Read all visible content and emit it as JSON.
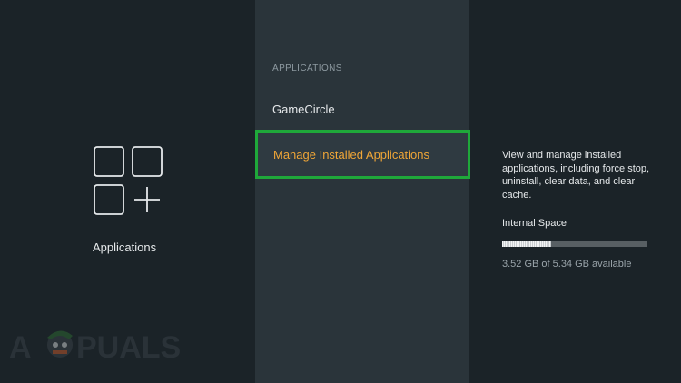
{
  "left": {
    "category_icon": "applications-grid-icon",
    "category_label": "Applications"
  },
  "center": {
    "section_header": "APPLICATIONS",
    "items": [
      {
        "label": "GameCircle",
        "selected": false
      },
      {
        "label": "Manage Installed Applications",
        "selected": true
      }
    ]
  },
  "right": {
    "description": "View and manage installed applications, including force stop, uninstall, clear data, and clear cache.",
    "storage": {
      "title": "Internal Space",
      "used_fraction": 0.34,
      "text": "3.52 GB of 5.34 GB available"
    }
  },
  "watermark": {
    "text": "A PUALS"
  },
  "colors": {
    "selection_border": "#1fa83a",
    "selected_text": "#f0a637",
    "panel_center": "#2a343a",
    "panel_side": "#1b2328"
  }
}
